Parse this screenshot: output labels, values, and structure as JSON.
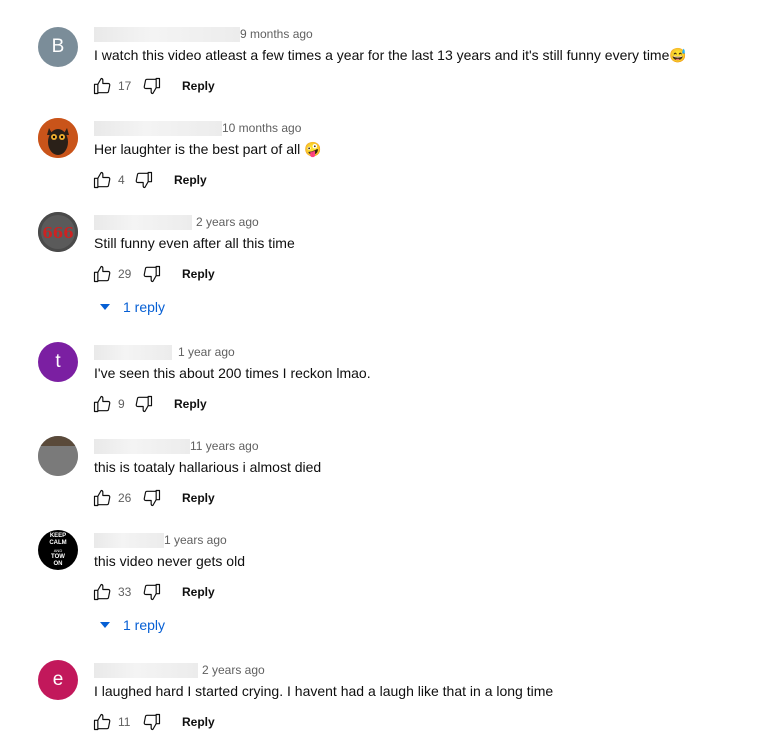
{
  "comments": [
    {
      "author_masked": "",
      "time": "9 months ago",
      "text": "I watch this video atleast a few times a year for the last 13 years and it's still funny every time😅",
      "likes": "17",
      "reply_label": "Reply",
      "avatar": {
        "type": "letter",
        "letter": "B",
        "color": "#7b8d99"
      }
    },
    {
      "author_masked": "",
      "time": "10 months ago",
      "text": "Her laughter is the best part of all 🤪",
      "likes": "4",
      "reply_label": "Reply",
      "avatar": {
        "type": "image",
        "image": "owl-avatar-icon"
      }
    },
    {
      "author_masked": "",
      "time": "2 years ago",
      "text": "Still funny even after all this time",
      "likes": "29",
      "reply_label": "Reply",
      "replies_label": "1 reply",
      "avatar": {
        "type": "image",
        "image": "666-avatar-icon",
        "label": "666"
      }
    },
    {
      "author_masked": "",
      "time": "1 year ago",
      "text": "I've seen this about 200 times I reckon  lmao.",
      "likes": "9",
      "reply_label": "Reply",
      "avatar": {
        "type": "letter",
        "letter": "t",
        "color": "#7b1fa2"
      }
    },
    {
      "author_masked": "",
      "time": "11 years ago",
      "text": "this is toataly hallarious i almost died",
      "likes": "26",
      "reply_label": "Reply",
      "avatar": {
        "type": "image",
        "image": "photo-avatar-icon"
      }
    },
    {
      "author_masked": "",
      "time": "1 years ago",
      "text": "this video never gets old",
      "likes": "33",
      "reply_label": "Reply",
      "replies_label": "1 reply",
      "avatar": {
        "type": "image",
        "image": "keep-calm-avatar-icon",
        "lines": [
          "KEEP",
          "CALM",
          "AND",
          "TOW",
          "ON"
        ]
      }
    },
    {
      "author_masked": "",
      "time": "2 years ago",
      "text": "I laughed hard I started crying. I havent had a laugh like that in a long time",
      "likes": "11",
      "reply_label": "Reply",
      "avatar": {
        "type": "letter",
        "letter": "e",
        "color": "#c2185b"
      }
    }
  ],
  "colors": {
    "link": "#065fd4",
    "secondary_text": "#606060"
  }
}
